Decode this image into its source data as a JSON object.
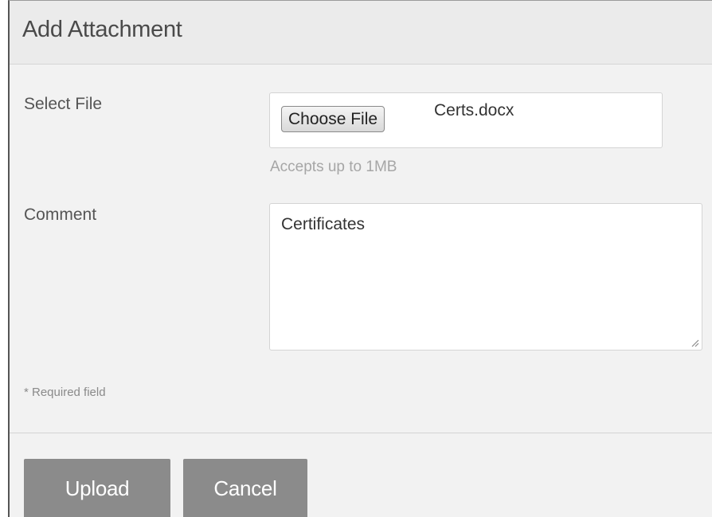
{
  "dialog": {
    "title": "Add Attachment"
  },
  "form": {
    "file_label": "Select File",
    "choose_file_label": "Choose File",
    "file_name": "Certs.docx",
    "file_help": "Accepts up to 1MB",
    "comment_label": "Comment",
    "comment_value": "Certificates",
    "required_note": "* Required field"
  },
  "actions": {
    "upload_label": "Upload",
    "cancel_label": "Cancel"
  },
  "colors": {
    "button_background": "#8b8b8b",
    "dialog_background": "#f2f2f2",
    "help_text": "#a6a6a6"
  },
  "icons": {
    "resize_grip": "resize-grip-icon"
  }
}
